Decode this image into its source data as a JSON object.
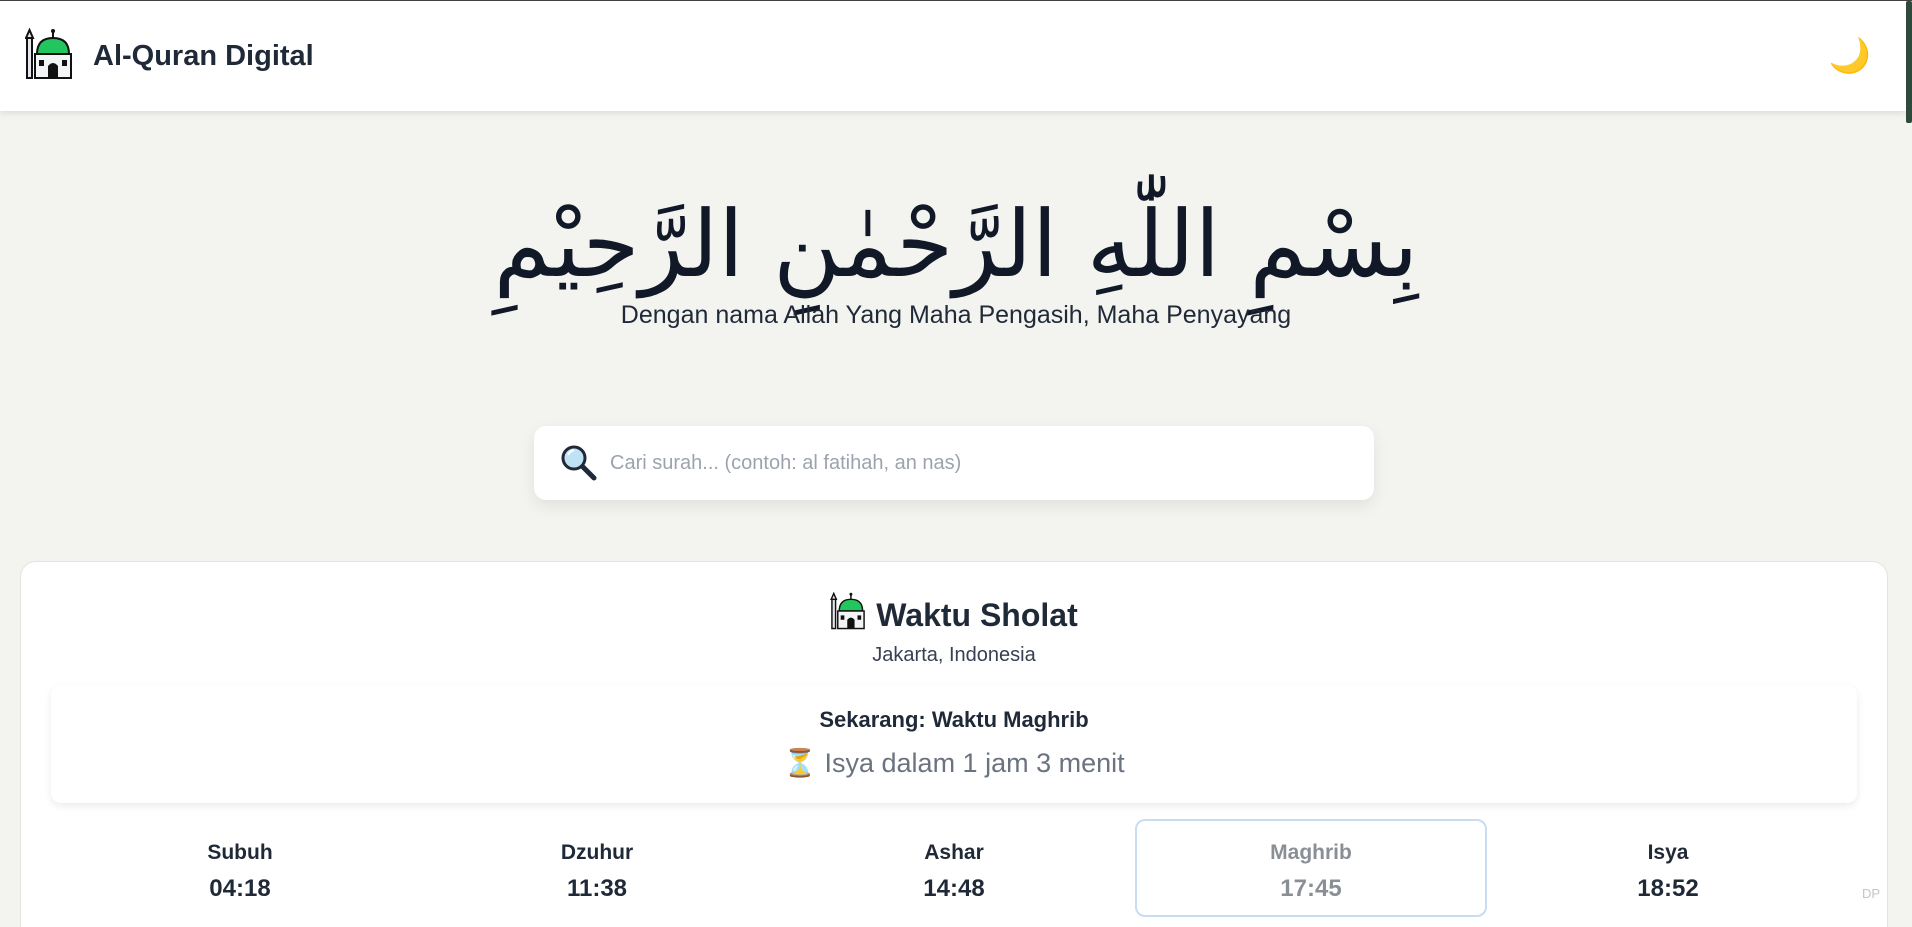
{
  "navbar": {
    "logo_icon": "mosque-icon",
    "title": "Al-Quran Digital",
    "theme_toggle_icon": "crescent-moon-icon",
    "theme_toggle_glyph": "🌙"
  },
  "hero": {
    "arabic": "بِسْمِ اللّٰهِ الرَّحْمٰنِ الرَّحِيْمِ",
    "translation": "Dengan nama Allah Yang Maha Pengasih, Maha Penyayang"
  },
  "search": {
    "icon": "magnifier-icon",
    "placeholder": "Cari surah... (contoh: al fatihah, an nas)",
    "value": ""
  },
  "prayer": {
    "title_icon": "mosque-icon",
    "title": "Waktu Sholat",
    "location": "Jakarta, Indonesia",
    "current_label": "Sekarang: Waktu Maghrib",
    "countdown_icon": "hourglass-icon",
    "countdown_glyph": "⏳",
    "countdown": "Isya dalam 1 jam 3 menit",
    "times": [
      {
        "name": "Subuh",
        "time": "04:18",
        "active": false
      },
      {
        "name": "Dzuhur",
        "time": "11:38",
        "active": false
      },
      {
        "name": "Ashar",
        "time": "14:48",
        "active": false
      },
      {
        "name": "Maghrib",
        "time": "17:45",
        "active": true
      },
      {
        "name": "Isya",
        "time": "18:52",
        "active": false
      }
    ]
  },
  "corner_tag": "DP",
  "colors": {
    "background": "#f3f3ef",
    "card": "#ffffff",
    "text": "#1f2937",
    "muted": "#6b7280",
    "active_border": "#c9dcf2",
    "dome_green": "#22c55e"
  }
}
